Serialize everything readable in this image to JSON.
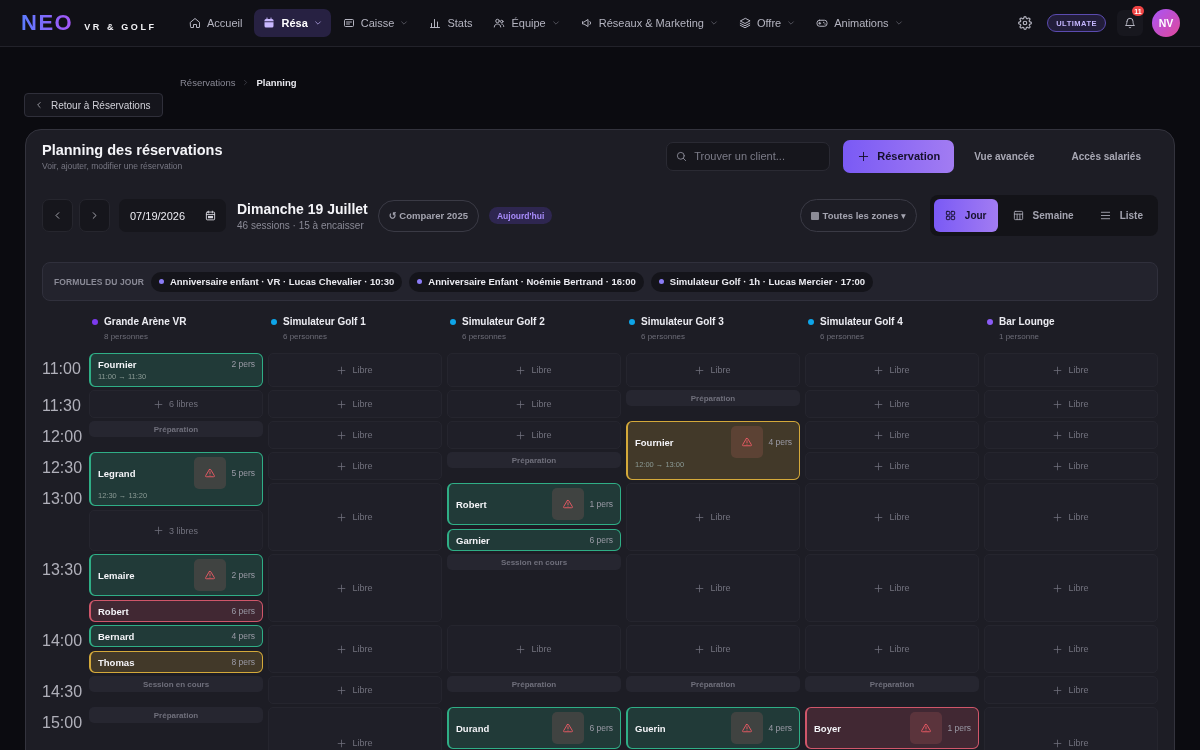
{
  "nav": {
    "logo": "NEO",
    "logo_sub": "VR & GOLF",
    "items": [
      {
        "label": "Accueil",
        "selected": false,
        "has_menu": false
      },
      {
        "label": "Résa",
        "selected": true,
        "has_menu": true
      },
      {
        "label": "Caisse",
        "selected": false,
        "has_menu": true
      },
      {
        "label": "Stats",
        "selected": false,
        "has_menu": false
      },
      {
        "label": "Équipe",
        "selected": false,
        "has_menu": true
      },
      {
        "label": "Réseaux & Marketing",
        "selected": false,
        "has_menu": true
      },
      {
        "label": "Offre",
        "selected": false,
        "has_menu": true
      },
      {
        "label": "Animations",
        "selected": false,
        "has_menu": true
      }
    ],
    "plan_badge": "ULTIMATE",
    "notification_count": "11",
    "avatar_initials": "NV"
  },
  "breadcrumb": [
    {
      "label": "Réservations",
      "current": false
    },
    {
      "label": "Planning",
      "current": true
    }
  ],
  "back_button": "Retour à Réservations",
  "planner": {
    "title": "Planning des réservations",
    "subtitle": "Voir, ajouter, modifier une réservation",
    "search": {
      "placeholder": "Trouver un client..."
    },
    "actions": [
      {
        "label": "Réservation",
        "kind": "primary"
      },
      {
        "label": "Vue avancée",
        "kind": "text"
      },
      {
        "label": "Accès salariés",
        "kind": "text"
      }
    ],
    "date_input": "07/19/2026",
    "day_title": "Dimanche 19 Juillet",
    "day_summary": "46 sessions · 15 à encaisser",
    "compare_button": "↺ Comparer 2025",
    "today_badge": "Aujourd'hui",
    "zone_filter": "Toutes les zones ▾",
    "views": [
      {
        "label": "Jour",
        "selected": true
      },
      {
        "label": "Semaine",
        "selected": false
      },
      {
        "label": "Liste",
        "selected": false
      }
    ],
    "formulas": {
      "label": "FORMULES DU JOUR",
      "items": [
        "Anniversaire enfant · VR · Lucas Chevalier · 10:30",
        "Anniversaire Enfant · Noémie Bertrand · 16:00",
        "Simulateur Golf · 1h · Lucas Mercier · 17:00"
      ]
    },
    "times": [
      "11:00",
      "11:30",
      "12:00",
      "12:30",
      "13:00",
      "13:30",
      "14:00",
      "14:30",
      "15:00"
    ],
    "columns": [
      {
        "name": "Grande Arène VR",
        "capacity": "8 personnes",
        "color": "#7c3aed",
        "cells": [
          {
            "tall": false,
            "items": [
              {
                "kind": "booking",
                "name": "Fournier",
                "party": "2 pers",
                "time": "11:00 → 11:30",
                "alert": false,
                "color": "#2fae86"
              }
            ]
          },
          {
            "tall": false,
            "items": [
              {
                "kind": "free",
                "label": "6 libres"
              }
            ]
          },
          {
            "tall": false,
            "items": [
              {
                "kind": "status",
                "label": "Préparation"
              }
            ]
          },
          {
            "tall": true,
            "items": [
              {
                "kind": "booking",
                "name": "Legrand",
                "party": "5 pers",
                "time": "12:30 → 13:20",
                "alert": true,
                "color": "#2fae86"
              },
              {
                "kind": "free",
                "label": "3 libres"
              }
            ]
          },
          {
            "tall": false,
            "items": [
              {
                "kind": "booking",
                "name": "Lemaire",
                "party": "2 pers",
                "alert": true,
                "color": "#2fae86"
              },
              {
                "kind": "booking",
                "name": "Robert",
                "party": "6 pers",
                "alert": false,
                "color": "#d0566a"
              }
            ]
          },
          {
            "tall": false,
            "items": [
              {
                "kind": "booking",
                "name": "Bernard",
                "party": "4 pers",
                "alert": false,
                "color": "#2fae86"
              },
              {
                "kind": "booking",
                "name": "Thomas",
                "party": "8 pers",
                "alert": false,
                "color": "#d4a93a"
              }
            ]
          },
          {
            "tall": false,
            "items": [
              {
                "kind": "status",
                "label": "Session en cours"
              }
            ]
          },
          {
            "tall": false,
            "items": [
              {
                "kind": "status",
                "label": "Préparation"
              }
            ]
          }
        ]
      },
      {
        "name": "Simulateur Golf 1",
        "capacity": "6 personnes",
        "color": "#0ea5e9",
        "cells": [
          {
            "tall": false,
            "items": [
              {
                "kind": "free",
                "label": "Libre"
              }
            ]
          },
          {
            "tall": false,
            "items": [
              {
                "kind": "free",
                "label": "Libre"
              }
            ]
          },
          {
            "tall": false,
            "items": [
              {
                "kind": "free",
                "label": "Libre"
              }
            ]
          },
          {
            "tall": false,
            "items": [
              {
                "kind": "free",
                "label": "Libre"
              }
            ]
          },
          {
            "tall": false,
            "items": [
              {
                "kind": "free",
                "label": "Libre"
              }
            ]
          },
          {
            "tall": false,
            "items": [
              {
                "kind": "free",
                "label": "Libre"
              }
            ]
          },
          {
            "tall": false,
            "items": [
              {
                "kind": "free",
                "label": "Libre"
              }
            ]
          },
          {
            "tall": false,
            "items": [
              {
                "kind": "free",
                "label": "Libre"
              }
            ]
          },
          {
            "tall": false,
            "items": [
              {
                "kind": "free",
                "label": "Libre"
              }
            ]
          }
        ]
      },
      {
        "name": "Simulateur Golf 2",
        "capacity": "6 personnes",
        "color": "#0ea5e9",
        "cells": [
          {
            "tall": false,
            "items": [
              {
                "kind": "free",
                "label": "Libre"
              }
            ]
          },
          {
            "tall": false,
            "items": [
              {
                "kind": "free",
                "label": "Libre"
              }
            ]
          },
          {
            "tall": false,
            "items": [
              {
                "kind": "free",
                "label": "Libre"
              }
            ]
          },
          {
            "tall": false,
            "items": [
              {
                "kind": "status",
                "label": "Préparation"
              }
            ]
          },
          {
            "tall": false,
            "items": [
              {
                "kind": "booking",
                "name": "Robert",
                "party": "1 pers",
                "alert": true,
                "color": "#2fae86"
              },
              {
                "kind": "booking",
                "name": "Garnier",
                "party": "6 pers",
                "alert": false,
                "color": "#2fae86"
              }
            ]
          },
          {
            "tall": false,
            "items": [
              {
                "kind": "status",
                "label": "Session en cours"
              }
            ]
          },
          {
            "tall": false,
            "items": [
              {
                "kind": "free",
                "label": "Libre"
              }
            ]
          },
          {
            "tall": false,
            "items": [
              {
                "kind": "status",
                "label": "Préparation"
              }
            ]
          },
          {
            "tall": false,
            "items": [
              {
                "kind": "booking",
                "name": "Durand",
                "party": "6 pers",
                "alert": true,
                "color": "#2fae86"
              }
            ]
          }
        ]
      },
      {
        "name": "Simulateur Golf 3",
        "capacity": "6 personnes",
        "color": "#0ea5e9",
        "cells": [
          {
            "tall": false,
            "items": [
              {
                "kind": "free",
                "label": "Libre"
              }
            ]
          },
          {
            "tall": false,
            "items": [
              {
                "kind": "status",
                "label": "Préparation"
              }
            ]
          },
          {
            "tall": true,
            "items": [
              {
                "kind": "booking",
                "name": "Fournier",
                "party": "4 pers",
                "time": "12:00 → 13:00",
                "alert": true,
                "color": "#d4a93a"
              }
            ]
          },
          {
            "tall": false,
            "items": [
              {
                "kind": "free",
                "label": "Libre"
              }
            ]
          },
          {
            "tall": false,
            "items": [
              {
                "kind": "free",
                "label": "Libre"
              }
            ]
          },
          {
            "tall": false,
            "items": [
              {
                "kind": "free",
                "label": "Libre"
              }
            ]
          },
          {
            "tall": false,
            "items": [
              {
                "kind": "status",
                "label": "Préparation"
              }
            ]
          },
          {
            "tall": false,
            "items": [
              {
                "kind": "booking",
                "name": "Guerin",
                "party": "4 pers",
                "alert": true,
                "color": "#2fae86"
              }
            ]
          }
        ]
      },
      {
        "name": "Simulateur Golf 4",
        "capacity": "6 personnes",
        "color": "#0ea5e9",
        "cells": [
          {
            "tall": false,
            "items": [
              {
                "kind": "free",
                "label": "Libre"
              }
            ]
          },
          {
            "tall": false,
            "items": [
              {
                "kind": "free",
                "label": "Libre"
              }
            ]
          },
          {
            "tall": false,
            "items": [
              {
                "kind": "free",
                "label": "Libre"
              }
            ]
          },
          {
            "tall": false,
            "items": [
              {
                "kind": "free",
                "label": "Libre"
              }
            ]
          },
          {
            "tall": false,
            "items": [
              {
                "kind": "free",
                "label": "Libre"
              }
            ]
          },
          {
            "tall": false,
            "items": [
              {
                "kind": "free",
                "label": "Libre"
              }
            ]
          },
          {
            "tall": false,
            "items": [
              {
                "kind": "free",
                "label": "Libre"
              }
            ]
          },
          {
            "tall": false,
            "items": [
              {
                "kind": "status",
                "label": "Préparation"
              }
            ]
          },
          {
            "tall": false,
            "items": [
              {
                "kind": "booking",
                "name": "Boyer",
                "party": "1 pers",
                "alert": true,
                "color": "#d0566a"
              }
            ]
          }
        ]
      },
      {
        "name": "Bar Lounge",
        "capacity": "1 personne",
        "color": "#8b5cf6",
        "cells": [
          {
            "tall": false,
            "items": [
              {
                "kind": "free",
                "label": "Libre"
              }
            ]
          },
          {
            "tall": false,
            "items": [
              {
                "kind": "free",
                "label": "Libre"
              }
            ]
          },
          {
            "tall": false,
            "items": [
              {
                "kind": "free",
                "label": "Libre"
              }
            ]
          },
          {
            "tall": false,
            "items": [
              {
                "kind": "free",
                "label": "Libre"
              }
            ]
          },
          {
            "tall": false,
            "items": [
              {
                "kind": "free",
                "label": "Libre"
              }
            ]
          },
          {
            "tall": false,
            "items": [
              {
                "kind": "free",
                "label": "Libre"
              }
            ]
          },
          {
            "tall": false,
            "items": [
              {
                "kind": "free",
                "label": "Libre"
              }
            ]
          },
          {
            "tall": false,
            "items": [
              {
                "kind": "free",
                "label": "Libre"
              }
            ]
          },
          {
            "tall": false,
            "items": [
              {
                "kind": "free",
                "label": "Libre"
              }
            ]
          }
        ]
      }
    ]
  }
}
